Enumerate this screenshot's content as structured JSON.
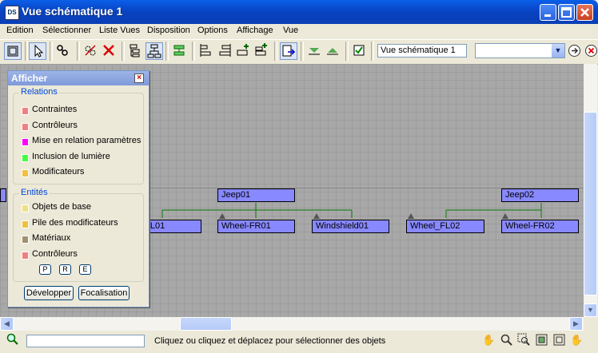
{
  "window": {
    "title": "Vue schématique 1",
    "icon_text": "DS"
  },
  "menu": [
    "Edition",
    "Sélectionner",
    "Liste Vues",
    "Disposition",
    "Options",
    "Affichage",
    "Vue"
  ],
  "toolbar": {
    "view_name": "Vue schématique 1",
    "combo_value": ""
  },
  "nodes": [
    {
      "label": "Jeep01"
    },
    {
      "label": "Jeep02"
    },
    {
      "label": "_FL01"
    },
    {
      "label": "Wheel-FR01"
    },
    {
      "label": "Windshield01"
    },
    {
      "label": "Wheel_FL02"
    },
    {
      "label": "Wheel-FR02"
    }
  ],
  "panel": {
    "title": "Afficher",
    "relations_title": "Relations",
    "relations": [
      {
        "label": "Contraintes",
        "color": "#F08080"
      },
      {
        "label": "Contrôleurs",
        "color": "#F08080"
      },
      {
        "label": "Mise en relation paramètres",
        "color": "#FF00FF"
      },
      {
        "label": "Inclusion de lumière",
        "color": "#40FF40"
      },
      {
        "label": "Modificateurs",
        "color": "#F0C040"
      }
    ],
    "entities_title": "Entités",
    "entities": [
      {
        "label": "Objets de base",
        "color": "#F0E080"
      },
      {
        "label": "Pile des modificateurs",
        "color": "#F0C040"
      },
      {
        "label": "Matériaux",
        "color": "#A09070"
      },
      {
        "label": "Contrôleurs",
        "color": "#F08080"
      }
    ],
    "small_buttons": [
      "P",
      "R",
      "E"
    ],
    "expand_label": "Développer",
    "focus_label": "Focalisation"
  },
  "status": {
    "text": "Cliquez ou cliquez et déplacez pour sélectionner des objets"
  }
}
